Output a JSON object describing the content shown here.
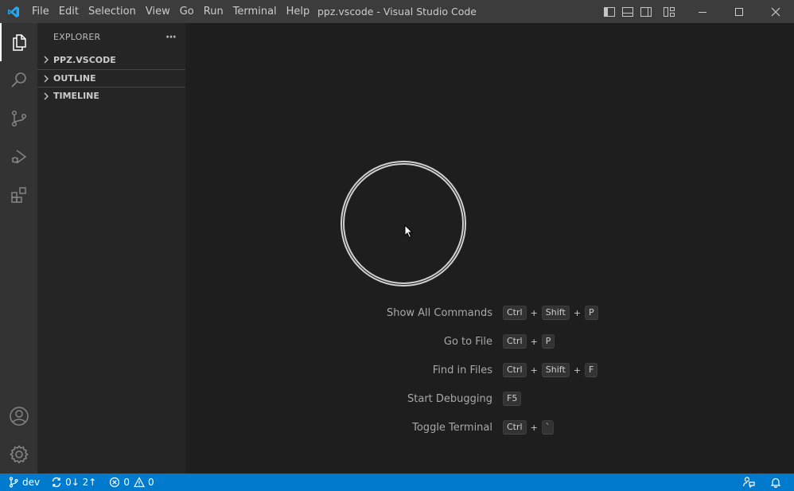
{
  "titlebar": {
    "menu": [
      "File",
      "Edit",
      "Selection",
      "View",
      "Go",
      "Run",
      "Terminal",
      "Help"
    ],
    "title": "ppz.vscode - Visual Studio Code"
  },
  "sidebar": {
    "header": "EXPLORER",
    "more": "···",
    "sections": [
      "PPZ.VSCODE",
      "OUTLINE",
      "TIMELINE"
    ]
  },
  "editor": {
    "shortcuts": [
      {
        "label": "Show All Commands",
        "keys": [
          "Ctrl",
          "Shift",
          "P"
        ]
      },
      {
        "label": "Go to File",
        "keys": [
          "Ctrl",
          "P"
        ]
      },
      {
        "label": "Find in Files",
        "keys": [
          "Ctrl",
          "Shift",
          "F"
        ]
      },
      {
        "label": "Start Debugging",
        "keys": [
          "F5"
        ]
      },
      {
        "label": "Toggle Terminal",
        "keys": [
          "Ctrl",
          "`"
        ]
      }
    ],
    "plus": "+"
  },
  "statusbar": {
    "branch": "dev",
    "sync": "0↓ 2↑",
    "errors": "0",
    "warnings": "0"
  },
  "colors": {
    "statusbar": "#007acc",
    "activitybar": "#333333",
    "sidebar": "#252526",
    "editor": "#1e1e1e",
    "titlebar": "#3c3c3c"
  }
}
